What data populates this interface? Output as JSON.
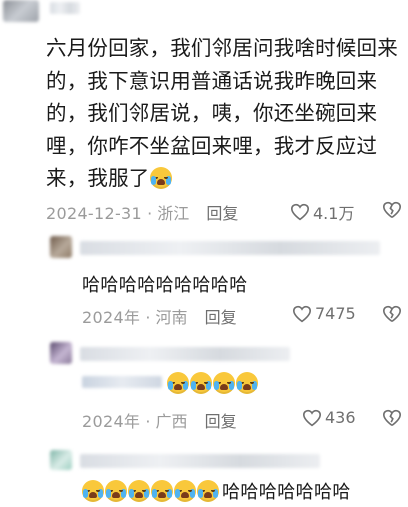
{
  "comments": [
    {
      "text": "六月份回家，我们邻居问我啥时候回来的，我下意识用普通话说我昨晚回来的，我们邻居说，咦，你还坐碗回来哩，你咋不坐盆回来哩，我才反应过来，我服了",
      "date": "2024-12-31",
      "location": "· 浙江",
      "reply_label": "回复",
      "likes": "4.1万",
      "emoji_count": 1,
      "emoji_name": "crying-laughing-emoji"
    },
    {
      "text": "哈哈哈哈哈哈哈哈哈",
      "date": "2024年",
      "location": "· 河南",
      "reply_label": "回复",
      "likes": "7475"
    },
    {
      "text": "",
      "date": "2024年",
      "location": "· 广西",
      "reply_label": "回复",
      "likes": "436",
      "emoji_count": 4,
      "emoji_name": "crying-laughing-emoji"
    },
    {
      "text": "哈哈哈哈哈哈哈",
      "emoji_count": 6,
      "emoji_name": "crying-laughing-emoji"
    }
  ],
  "icons": {
    "like": "heart-outline-icon",
    "dislike": "broken-heart-icon"
  },
  "colors": {
    "meta": "#9b9b9b",
    "emoji": "#f9c83b",
    "tear": "#4fb3f0"
  }
}
